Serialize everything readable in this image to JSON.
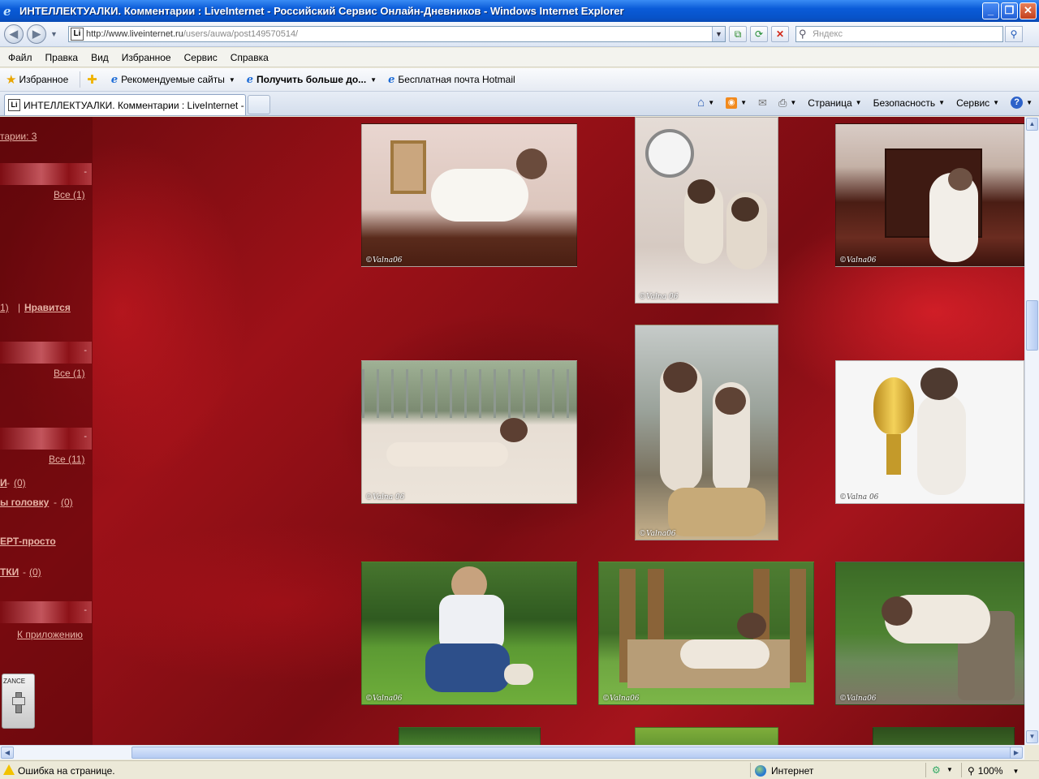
{
  "window": {
    "title": "ИНТЕЛЛЕКТУАЛКИ. Комментарии : LiveInternet - Российский Сервис Онлайн-Дневников - Windows Internet Explorer",
    "min": "_",
    "max": "❐",
    "close": "✕"
  },
  "address": {
    "url_host": "http://www.liveinternet.ru",
    "url_path": "/users/auwa/post149570514/",
    "favicon": "Li"
  },
  "search": {
    "placeholder": "Яндекс"
  },
  "menu": [
    "Файл",
    "Правка",
    "Вид",
    "Избранное",
    "Сервис",
    "Справка"
  ],
  "favorites": {
    "label": "Избранное",
    "items": [
      "Рекомендуемые сайты",
      "Получить больше до...",
      "Бесплатная почта Hotmail"
    ]
  },
  "tab": {
    "title": "ИНТЕЛЛЕКТУАЛКИ. Комментарии : LiveInternet - Ро..."
  },
  "commands": {
    "page": "Страница",
    "security": "Безопасность",
    "tools": "Сервис",
    "help": "?"
  },
  "sidebar": {
    "comments_link": "тарии: 3",
    "bar_dash": "-",
    "all_1": "Все (1)",
    "like_count": "1)",
    "like_sep": "|",
    "like": "Нравится",
    "all_1b": "Все (1)",
    "all_11": "Все (11)",
    "item_m": "И",
    "item_m_count": "(0)",
    "item_head": "ы головку",
    "item_head_count": "(0)",
    "item_expert": "ЕРТ-просто",
    "item_tki": "ТКИ",
    "item_tki_count": "(0)",
    "to_app": "К приложению",
    "widget_label": "ZANCE"
  },
  "photos": {
    "watermark_a": "©Valna06",
    "watermark_b": "©Valna 06"
  },
  "status": {
    "text": "Ошибка на странице.",
    "zone": "Интернет",
    "zoom": "100%"
  }
}
